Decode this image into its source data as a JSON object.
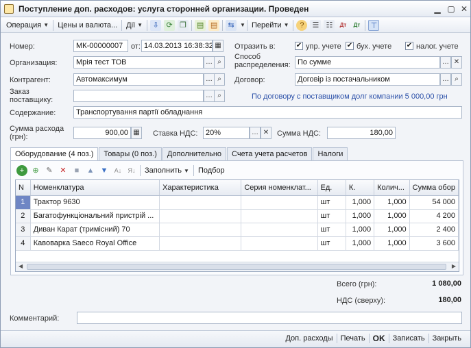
{
  "window": {
    "title": "Поступление доп. расходов: услуга сторонней организации. Проведен"
  },
  "toolbar": {
    "operation": "Операция",
    "prices": "Цены и валюта...",
    "actions": "Дії",
    "goto": "Перейти"
  },
  "form": {
    "number_label": "Номер:",
    "number_value": "МК-00000007",
    "date_label": "от:",
    "date_value": "14.03.2013 16:38:32",
    "reflect_label": "Отразить в:",
    "reflect_upr": "упр. учете",
    "reflect_buh": "бух. учете",
    "reflect_nalog": "налог. учете",
    "org_label": "Организация:",
    "org_value": "Мрія тест ТОВ",
    "distribution_label": "Способ распределения:",
    "distribution_value": "По сумме",
    "contractor_label": "Контрагент:",
    "contractor_value": "Автомаксимум",
    "contract_label": "Договор:",
    "contract_value": "Договір із постачальником",
    "order_label": "Заказ поставщику:",
    "order_value": "",
    "debt_info": "По договору с поставщиком долг компании 5 000,00 грн",
    "content_label": "Содержание:",
    "content_value": "Транспортування партії обладнання",
    "sum_label": "Сумма расхода (грн):",
    "sum_value": "900,00",
    "vat_rate_label": "Ставка НДС:",
    "vat_rate_value": "20%",
    "vat_sum_label": "Сумма НДС:",
    "vat_sum_value": "180,00"
  },
  "tabs": [
    {
      "label": "Оборудование (4 поз.)"
    },
    {
      "label": "Товары (0 поз.)"
    },
    {
      "label": "Дополнительно"
    },
    {
      "label": "Счета учета расчетов"
    },
    {
      "label": "Налоги"
    }
  ],
  "table_toolbar": {
    "fill": "Заполнить",
    "select": "Подбор"
  },
  "table": {
    "columns": [
      "N",
      "Номенклатура",
      "Характеристика",
      "Серия номенклат...",
      "Ед.",
      "К.",
      "Колич...",
      "Сумма обор"
    ],
    "rows": [
      [
        "1",
        "Трактор 9630",
        "",
        "",
        "шт",
        "1,000",
        "1,000",
        "54 000"
      ],
      [
        "2",
        "Багатофункціональний пристрій ...",
        "",
        "",
        "шт",
        "1,000",
        "1,000",
        "4 200"
      ],
      [
        "3",
        "Диван Карат (тримісний) 70",
        "",
        "",
        "шт",
        "1,000",
        "1,000",
        "2 400"
      ],
      [
        "4",
        "Кавоварка Saeco Royal Office",
        "",
        "",
        "шт",
        "1,000",
        "1,000",
        "3 600"
      ]
    ]
  },
  "totals": {
    "total_label": "Всего (грн):",
    "total_value": "1 080,00",
    "vat_label": "НДС (сверху):",
    "vat_value": "180,00"
  },
  "comment": {
    "label": "Комментарий:",
    "value": ""
  },
  "bottom": {
    "extra_costs": "Доп. расходы",
    "print": "Печать",
    "ok": "OK",
    "save": "Записать",
    "close": "Закрыть"
  }
}
